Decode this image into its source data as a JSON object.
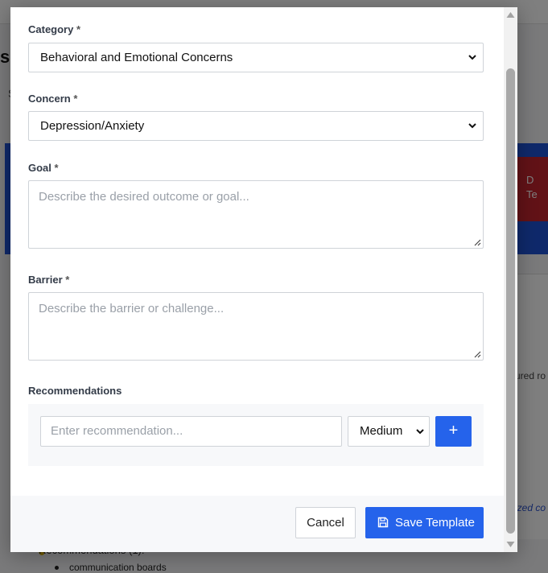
{
  "background": {
    "title_fragment": "s(",
    "sub_fragment": "S",
    "alert_fragment_1": "D",
    "alert_fragment_2": "Te",
    "text_fragment_1": "ured ro",
    "text_fragment_2": "ized co",
    "recommendations_heading": "Recommendations (1):",
    "recommendation_item": "communication boards"
  },
  "form": {
    "category": {
      "label": "Category",
      "required_mark": "*",
      "value": "Behavioral and Emotional Concerns"
    },
    "concern": {
      "label": "Concern",
      "required_mark": "*",
      "value": "Depression/Anxiety"
    },
    "goal": {
      "label": "Goal",
      "required_mark": "*",
      "placeholder": "Describe the desired outcome or goal..."
    },
    "barrier": {
      "label": "Barrier",
      "required_mark": "*",
      "placeholder": "Describe the barrier or challenge..."
    },
    "recommendations": {
      "label": "Recommendations",
      "input_placeholder": "Enter recommendation...",
      "priority_value": "Medium",
      "add_label": "+"
    }
  },
  "footer": {
    "cancel_label": "Cancel",
    "save_label": "Save Template"
  },
  "colors": {
    "primary": "#2563eb",
    "border": "#cfd3d8",
    "label": "#333b48",
    "placeholder": "#9aa0a8"
  }
}
